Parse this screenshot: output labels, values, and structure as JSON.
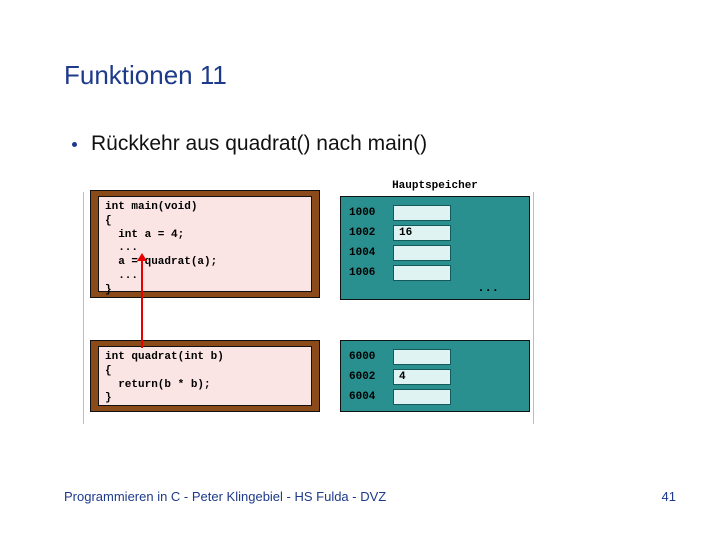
{
  "title": "Funktionen 11",
  "bullet": "Rückkehr aus quadrat() nach main()",
  "code": {
    "main": "int main(void)\n{\n  int a = 4;\n  ...\n  a = quadrat(a);\n  ...\n}",
    "quadrat": "int quadrat(int b)\n{\n  return(b * b);\n}"
  },
  "memory": {
    "title": "Hauptspeicher",
    "top_rows": [
      {
        "addr": "1000",
        "val": ""
      },
      {
        "addr": "1002",
        "val": "16"
      },
      {
        "addr": "1004",
        "val": ""
      },
      {
        "addr": "1006",
        "val": ""
      }
    ],
    "ellipsis": "...",
    "bot_rows": [
      {
        "addr": "6000",
        "val": ""
      },
      {
        "addr": "6002",
        "val": "4"
      },
      {
        "addr": "6004",
        "val": ""
      }
    ]
  },
  "footer": {
    "left": "Programmieren in C - Peter Klingebiel - HS Fulda - DVZ",
    "page": "41"
  }
}
